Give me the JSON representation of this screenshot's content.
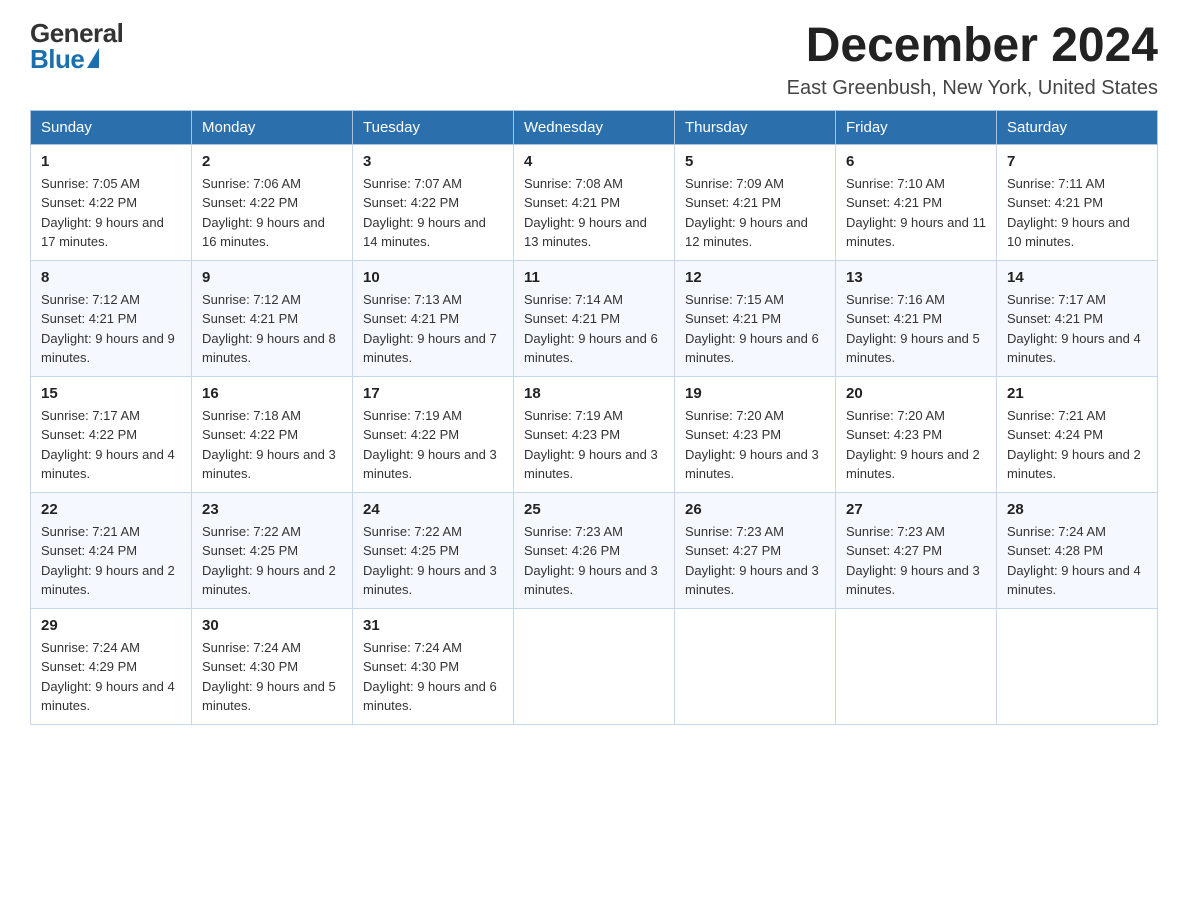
{
  "header": {
    "logo_general": "General",
    "logo_blue": "Blue",
    "month_title": "December 2024",
    "location": "East Greenbush, New York, United States"
  },
  "weekdays": [
    "Sunday",
    "Monday",
    "Tuesday",
    "Wednesday",
    "Thursday",
    "Friday",
    "Saturday"
  ],
  "weeks": [
    [
      {
        "day": "1",
        "sunrise": "7:05 AM",
        "sunset": "4:22 PM",
        "daylight": "9 hours and 17 minutes."
      },
      {
        "day": "2",
        "sunrise": "7:06 AM",
        "sunset": "4:22 PM",
        "daylight": "9 hours and 16 minutes."
      },
      {
        "day": "3",
        "sunrise": "7:07 AM",
        "sunset": "4:22 PM",
        "daylight": "9 hours and 14 minutes."
      },
      {
        "day": "4",
        "sunrise": "7:08 AM",
        "sunset": "4:21 PM",
        "daylight": "9 hours and 13 minutes."
      },
      {
        "day": "5",
        "sunrise": "7:09 AM",
        "sunset": "4:21 PM",
        "daylight": "9 hours and 12 minutes."
      },
      {
        "day": "6",
        "sunrise": "7:10 AM",
        "sunset": "4:21 PM",
        "daylight": "9 hours and 11 minutes."
      },
      {
        "day": "7",
        "sunrise": "7:11 AM",
        "sunset": "4:21 PM",
        "daylight": "9 hours and 10 minutes."
      }
    ],
    [
      {
        "day": "8",
        "sunrise": "7:12 AM",
        "sunset": "4:21 PM",
        "daylight": "9 hours and 9 minutes."
      },
      {
        "day": "9",
        "sunrise": "7:12 AM",
        "sunset": "4:21 PM",
        "daylight": "9 hours and 8 minutes."
      },
      {
        "day": "10",
        "sunrise": "7:13 AM",
        "sunset": "4:21 PM",
        "daylight": "9 hours and 7 minutes."
      },
      {
        "day": "11",
        "sunrise": "7:14 AM",
        "sunset": "4:21 PM",
        "daylight": "9 hours and 6 minutes."
      },
      {
        "day": "12",
        "sunrise": "7:15 AM",
        "sunset": "4:21 PM",
        "daylight": "9 hours and 6 minutes."
      },
      {
        "day": "13",
        "sunrise": "7:16 AM",
        "sunset": "4:21 PM",
        "daylight": "9 hours and 5 minutes."
      },
      {
        "day": "14",
        "sunrise": "7:17 AM",
        "sunset": "4:21 PM",
        "daylight": "9 hours and 4 minutes."
      }
    ],
    [
      {
        "day": "15",
        "sunrise": "7:17 AM",
        "sunset": "4:22 PM",
        "daylight": "9 hours and 4 minutes."
      },
      {
        "day": "16",
        "sunrise": "7:18 AM",
        "sunset": "4:22 PM",
        "daylight": "9 hours and 3 minutes."
      },
      {
        "day": "17",
        "sunrise": "7:19 AM",
        "sunset": "4:22 PM",
        "daylight": "9 hours and 3 minutes."
      },
      {
        "day": "18",
        "sunrise": "7:19 AM",
        "sunset": "4:23 PM",
        "daylight": "9 hours and 3 minutes."
      },
      {
        "day": "19",
        "sunrise": "7:20 AM",
        "sunset": "4:23 PM",
        "daylight": "9 hours and 3 minutes."
      },
      {
        "day": "20",
        "sunrise": "7:20 AM",
        "sunset": "4:23 PM",
        "daylight": "9 hours and 2 minutes."
      },
      {
        "day": "21",
        "sunrise": "7:21 AM",
        "sunset": "4:24 PM",
        "daylight": "9 hours and 2 minutes."
      }
    ],
    [
      {
        "day": "22",
        "sunrise": "7:21 AM",
        "sunset": "4:24 PM",
        "daylight": "9 hours and 2 minutes."
      },
      {
        "day": "23",
        "sunrise": "7:22 AM",
        "sunset": "4:25 PM",
        "daylight": "9 hours and 2 minutes."
      },
      {
        "day": "24",
        "sunrise": "7:22 AM",
        "sunset": "4:25 PM",
        "daylight": "9 hours and 3 minutes."
      },
      {
        "day": "25",
        "sunrise": "7:23 AM",
        "sunset": "4:26 PM",
        "daylight": "9 hours and 3 minutes."
      },
      {
        "day": "26",
        "sunrise": "7:23 AM",
        "sunset": "4:27 PM",
        "daylight": "9 hours and 3 minutes."
      },
      {
        "day": "27",
        "sunrise": "7:23 AM",
        "sunset": "4:27 PM",
        "daylight": "9 hours and 3 minutes."
      },
      {
        "day": "28",
        "sunrise": "7:24 AM",
        "sunset": "4:28 PM",
        "daylight": "9 hours and 4 minutes."
      }
    ],
    [
      {
        "day": "29",
        "sunrise": "7:24 AM",
        "sunset": "4:29 PM",
        "daylight": "9 hours and 4 minutes."
      },
      {
        "day": "30",
        "sunrise": "7:24 AM",
        "sunset": "4:30 PM",
        "daylight": "9 hours and 5 minutes."
      },
      {
        "day": "31",
        "sunrise": "7:24 AM",
        "sunset": "4:30 PM",
        "daylight": "9 hours and 6 minutes."
      },
      null,
      null,
      null,
      null
    ]
  ]
}
